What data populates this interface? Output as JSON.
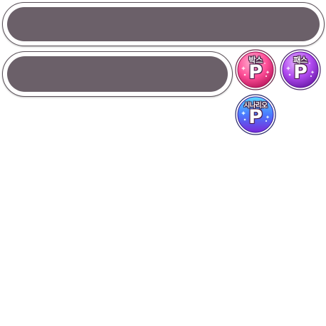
{
  "panels": {
    "top_bar": {},
    "second_bar": {}
  },
  "coins": [
    {
      "label": "박스",
      "symbol": "P",
      "color_light": "#ff8ab8",
      "color_dark": "#d0246e",
      "rim": "#b01a5c"
    },
    {
      "label": "패스",
      "symbol": "P",
      "color_light": "#d48cff",
      "color_dark": "#8a2ad0",
      "rim": "#6a1aa8"
    },
    {
      "label": "시나리오",
      "symbol": "P",
      "color_light": "#7ad8ff",
      "color_dark": "#6a3ae0",
      "rim": "#3a2ab0"
    }
  ],
  "colors": {
    "bar_fill": "#6b6069",
    "bar_border": "#5a5058",
    "background": "#ffffff"
  }
}
